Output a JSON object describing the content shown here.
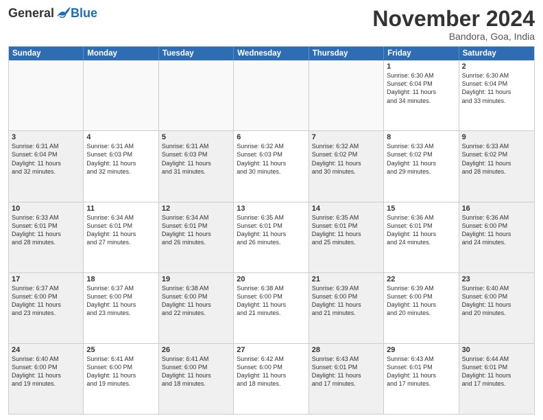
{
  "header": {
    "logo": {
      "general": "General",
      "blue": "Blue"
    },
    "title": "November 2024",
    "location": "Bandora, Goa, India"
  },
  "calendar": {
    "weekdays": [
      "Sunday",
      "Monday",
      "Tuesday",
      "Wednesday",
      "Thursday",
      "Friday",
      "Saturday"
    ],
    "rows": [
      [
        {
          "day": "",
          "empty": true
        },
        {
          "day": "",
          "empty": true
        },
        {
          "day": "",
          "empty": true
        },
        {
          "day": "",
          "empty": true
        },
        {
          "day": "",
          "empty": true
        },
        {
          "day": "1",
          "lines": [
            "Sunrise: 6:30 AM",
            "Sunset: 6:04 PM",
            "Daylight: 11 hours",
            "and 34 minutes."
          ]
        },
        {
          "day": "2",
          "lines": [
            "Sunrise: 6:30 AM",
            "Sunset: 6:04 PM",
            "Daylight: 11 hours",
            "and 33 minutes."
          ]
        }
      ],
      [
        {
          "day": "3",
          "shaded": true,
          "lines": [
            "Sunrise: 6:31 AM",
            "Sunset: 6:04 PM",
            "Daylight: 11 hours",
            "and 32 minutes."
          ]
        },
        {
          "day": "4",
          "lines": [
            "Sunrise: 6:31 AM",
            "Sunset: 6:03 PM",
            "Daylight: 11 hours",
            "and 32 minutes."
          ]
        },
        {
          "day": "5",
          "shaded": true,
          "lines": [
            "Sunrise: 6:31 AM",
            "Sunset: 6:03 PM",
            "Daylight: 11 hours",
            "and 31 minutes."
          ]
        },
        {
          "day": "6",
          "lines": [
            "Sunrise: 6:32 AM",
            "Sunset: 6:03 PM",
            "Daylight: 11 hours",
            "and 30 minutes."
          ]
        },
        {
          "day": "7",
          "shaded": true,
          "lines": [
            "Sunrise: 6:32 AM",
            "Sunset: 6:02 PM",
            "Daylight: 11 hours",
            "and 30 minutes."
          ]
        },
        {
          "day": "8",
          "lines": [
            "Sunrise: 6:33 AM",
            "Sunset: 6:02 PM",
            "Daylight: 11 hours",
            "and 29 minutes."
          ]
        },
        {
          "day": "9",
          "shaded": true,
          "lines": [
            "Sunrise: 6:33 AM",
            "Sunset: 6:02 PM",
            "Daylight: 11 hours",
            "and 28 minutes."
          ]
        }
      ],
      [
        {
          "day": "10",
          "shaded": true,
          "lines": [
            "Sunrise: 6:33 AM",
            "Sunset: 6:01 PM",
            "Daylight: 11 hours",
            "and 28 minutes."
          ]
        },
        {
          "day": "11",
          "lines": [
            "Sunrise: 6:34 AM",
            "Sunset: 6:01 PM",
            "Daylight: 11 hours",
            "and 27 minutes."
          ]
        },
        {
          "day": "12",
          "shaded": true,
          "lines": [
            "Sunrise: 6:34 AM",
            "Sunset: 6:01 PM",
            "Daylight: 11 hours",
            "and 26 minutes."
          ]
        },
        {
          "day": "13",
          "lines": [
            "Sunrise: 6:35 AM",
            "Sunset: 6:01 PM",
            "Daylight: 11 hours",
            "and 26 minutes."
          ]
        },
        {
          "day": "14",
          "shaded": true,
          "lines": [
            "Sunrise: 6:35 AM",
            "Sunset: 6:01 PM",
            "Daylight: 11 hours",
            "and 25 minutes."
          ]
        },
        {
          "day": "15",
          "lines": [
            "Sunrise: 6:36 AM",
            "Sunset: 6:01 PM",
            "Daylight: 11 hours",
            "and 24 minutes."
          ]
        },
        {
          "day": "16",
          "shaded": true,
          "lines": [
            "Sunrise: 6:36 AM",
            "Sunset: 6:00 PM",
            "Daylight: 11 hours",
            "and 24 minutes."
          ]
        }
      ],
      [
        {
          "day": "17",
          "shaded": true,
          "lines": [
            "Sunrise: 6:37 AM",
            "Sunset: 6:00 PM",
            "Daylight: 11 hours",
            "and 23 minutes."
          ]
        },
        {
          "day": "18",
          "lines": [
            "Sunrise: 6:37 AM",
            "Sunset: 6:00 PM",
            "Daylight: 11 hours",
            "and 23 minutes."
          ]
        },
        {
          "day": "19",
          "shaded": true,
          "lines": [
            "Sunrise: 6:38 AM",
            "Sunset: 6:00 PM",
            "Daylight: 11 hours",
            "and 22 minutes."
          ]
        },
        {
          "day": "20",
          "lines": [
            "Sunrise: 6:38 AM",
            "Sunset: 6:00 PM",
            "Daylight: 11 hours",
            "and 21 minutes."
          ]
        },
        {
          "day": "21",
          "shaded": true,
          "lines": [
            "Sunrise: 6:39 AM",
            "Sunset: 6:00 PM",
            "Daylight: 11 hours",
            "and 21 minutes."
          ]
        },
        {
          "day": "22",
          "lines": [
            "Sunrise: 6:39 AM",
            "Sunset: 6:00 PM",
            "Daylight: 11 hours",
            "and 20 minutes."
          ]
        },
        {
          "day": "23",
          "shaded": true,
          "lines": [
            "Sunrise: 6:40 AM",
            "Sunset: 6:00 PM",
            "Daylight: 11 hours",
            "and 20 minutes."
          ]
        }
      ],
      [
        {
          "day": "24",
          "shaded": true,
          "lines": [
            "Sunrise: 6:40 AM",
            "Sunset: 6:00 PM",
            "Daylight: 11 hours",
            "and 19 minutes."
          ]
        },
        {
          "day": "25",
          "lines": [
            "Sunrise: 6:41 AM",
            "Sunset: 6:00 PM",
            "Daylight: 11 hours",
            "and 19 minutes."
          ]
        },
        {
          "day": "26",
          "shaded": true,
          "lines": [
            "Sunrise: 6:41 AM",
            "Sunset: 6:00 PM",
            "Daylight: 11 hours",
            "and 18 minutes."
          ]
        },
        {
          "day": "27",
          "lines": [
            "Sunrise: 6:42 AM",
            "Sunset: 6:00 PM",
            "Daylight: 11 hours",
            "and 18 minutes."
          ]
        },
        {
          "day": "28",
          "shaded": true,
          "lines": [
            "Sunrise: 6:43 AM",
            "Sunset: 6:01 PM",
            "Daylight: 11 hours",
            "and 17 minutes."
          ]
        },
        {
          "day": "29",
          "lines": [
            "Sunrise: 6:43 AM",
            "Sunset: 6:01 PM",
            "Daylight: 11 hours",
            "and 17 minutes."
          ]
        },
        {
          "day": "30",
          "shaded": true,
          "lines": [
            "Sunrise: 6:44 AM",
            "Sunset: 6:01 PM",
            "Daylight: 11 hours",
            "and 17 minutes."
          ]
        }
      ]
    ]
  }
}
